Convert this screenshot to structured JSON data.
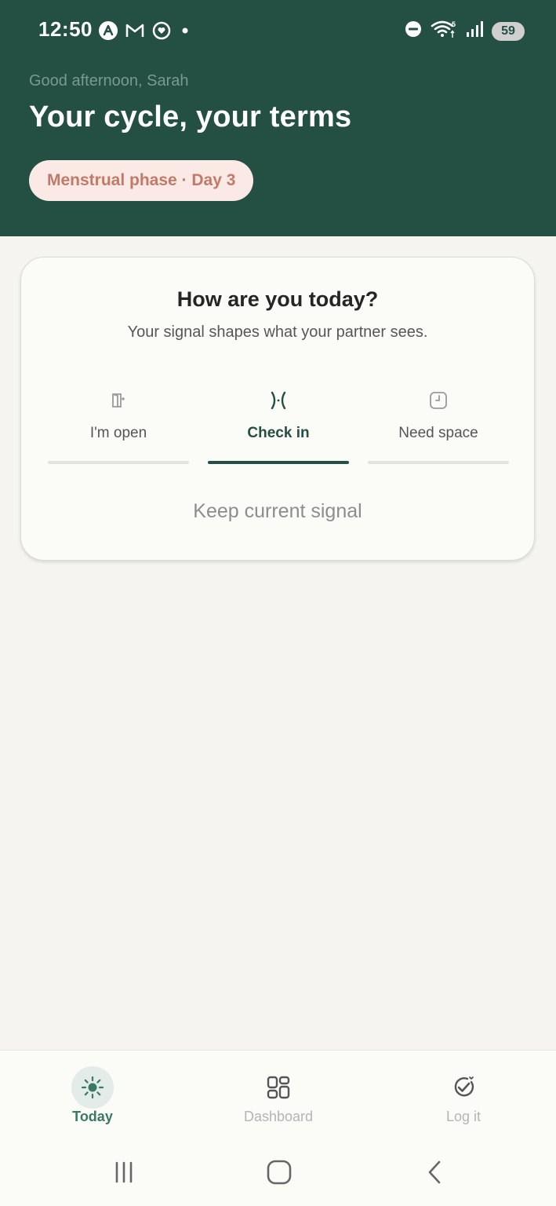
{
  "status_bar": {
    "time": "12:50",
    "battery": "59",
    "network_label": "5"
  },
  "header": {
    "greeting": "Good afternoon, Sarah",
    "headline": "Your cycle, your terms",
    "phase_pill": "Menstrual phase · Day 3"
  },
  "card": {
    "title": "How are you today?",
    "subtitle": "Your signal shapes what your partner sees.",
    "options": [
      {
        "label": "I'm open",
        "icon": "door-icon",
        "active": false
      },
      {
        "label": "Check in",
        "icon": "check-in-icon",
        "active": true
      },
      {
        "label": "Need space",
        "icon": "clock-icon",
        "active": false
      }
    ],
    "keep_signal": "Keep current signal"
  },
  "bottom_nav": {
    "items": [
      {
        "label": "Today",
        "icon": "sun-icon",
        "active": true
      },
      {
        "label": "Dashboard",
        "icon": "dashboard-icon",
        "active": false
      },
      {
        "label": "Log it",
        "icon": "check-circle-icon",
        "active": false
      }
    ]
  },
  "colors": {
    "header_bg": "#244f43",
    "accent": "#244f43",
    "pill_bg": "#fbe9e6",
    "pill_text": "#c27a68",
    "page_bg": "#f5f4f0",
    "nav_active": "#3a7a63"
  }
}
